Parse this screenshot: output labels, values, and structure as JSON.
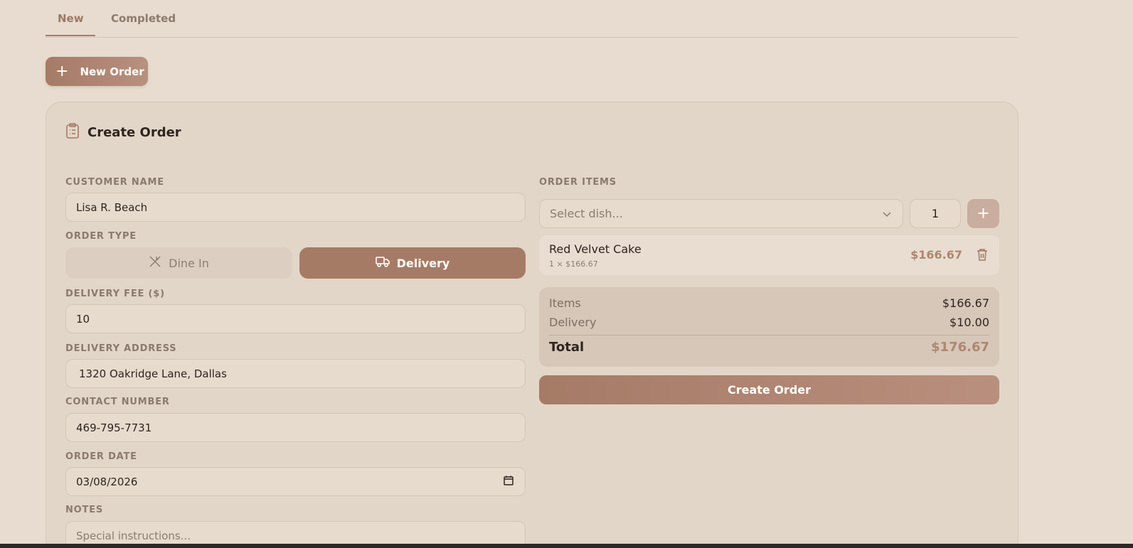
{
  "tabs": [
    {
      "label": "New",
      "active": true
    },
    {
      "label": "Completed",
      "active": false
    }
  ],
  "new_order_button": {
    "label": "New Order",
    "icon": "plus-icon"
  },
  "card": {
    "title": "Create Order",
    "icon": "clipboard-icon"
  },
  "form": {
    "customer_name": {
      "label": "CUSTOMER NAME",
      "value": "Lisa R. Beach"
    },
    "order_type": {
      "label": "ORDER TYPE",
      "options": [
        {
          "label": "Dine In",
          "icon": "utensils-crossed-icon",
          "selected": false
        },
        {
          "label": "Delivery",
          "icon": "truck-icon",
          "selected": true
        }
      ]
    },
    "delivery_fee": {
      "label": "DELIVERY FEE ($)",
      "value": "10"
    },
    "delivery_address": {
      "label": "DELIVERY ADDRESS",
      "value": "1320 Oakridge Lane, Dallas"
    },
    "contact_number": {
      "label": "CONTACT NUMBER",
      "value": "469-795-7731"
    },
    "order_date": {
      "label": "ORDER DATE",
      "value": "03/08/2026",
      "icon": "calendar-icon"
    },
    "notes": {
      "label": "NOTES",
      "placeholder": "Special instructions..."
    }
  },
  "order_items": {
    "label": "ORDER ITEMS",
    "dish_select_placeholder": "Select dish...",
    "quantity": "1",
    "items": [
      {
        "name": "Red Velvet Cake",
        "detail": "1 × $166.67",
        "price": "$166.67"
      }
    ]
  },
  "summary": {
    "items_label": "Items",
    "items_value": "$166.67",
    "delivery_label": "Delivery",
    "delivery_value": "$10.00",
    "total_label": "Total",
    "total_value": "$176.67"
  },
  "create_order_button": "Create Order",
  "colors": {
    "background": "#e7dccf",
    "accent": "#a67b66",
    "price": "#b08670"
  }
}
